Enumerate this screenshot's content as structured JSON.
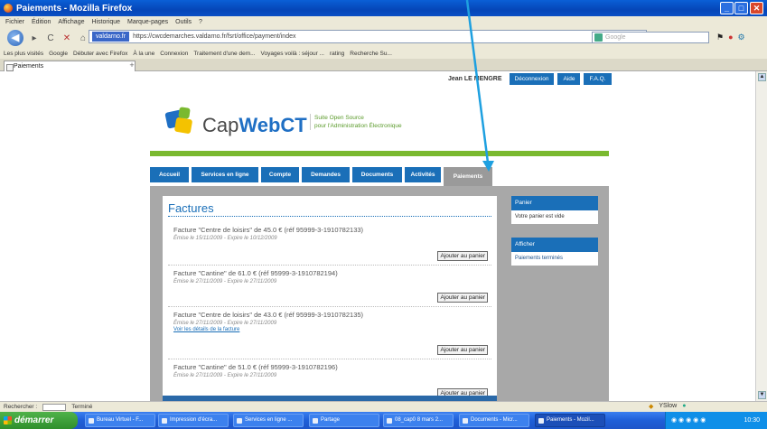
{
  "window": {
    "title": "Paiements - Mozilla Firefox",
    "controls": [
      "_",
      "□",
      "✕"
    ]
  },
  "menu": [
    "Fichier",
    "Édition",
    "Affichage",
    "Historique",
    "Marque-pages",
    "Outils",
    "?"
  ],
  "nav": {
    "back_icon": "◀",
    "forward_icon": "▸",
    "reload_icon": "C",
    "stop_icon": "✕",
    "home_icon": "⌂",
    "site_label": "valdarno.fr",
    "url": "https://cwcdemarches.valdarno.fr/fsrt/office/payment/index",
    "star_icon": "☆",
    "search_placeholder": "Google",
    "extra_icons": [
      "⚑",
      "●",
      "⚙"
    ]
  },
  "bookmarks": [
    "Les plus visités",
    "Google",
    "Débuter avec Firefox",
    "À la une",
    "Connexion",
    "Traitement d'une dem...",
    "Voyages voilà : séjour ...",
    "rating",
    "Recherche Su..."
  ],
  "browser_tab": {
    "label": "Paiements",
    "new_tab": "+"
  },
  "site": {
    "user": "Jean LE MENGRE",
    "user_buttons": [
      "Déconnexion",
      "Aide",
      "F.A.Q."
    ],
    "logo_cap": "Cap",
    "logo_webct": "WebCT",
    "tagline_1": "Suite Open Source",
    "tagline_2": "pour l'Administration Électronique",
    "tabs": [
      {
        "label": "Accueil",
        "w": 43
      },
      {
        "label": "Services en ligne",
        "w": 74
      },
      {
        "label": "Compte",
        "w": 42
      },
      {
        "label": "Demandes",
        "w": 53
      },
      {
        "label": "Documents",
        "w": 55
      },
      {
        "label": "Activités",
        "w": 40
      },
      {
        "label": "Paiements",
        "w": 54,
        "active": true
      }
    ],
    "section_title": "Factures",
    "invoices": [
      {
        "title": "Facture \"Centre de loisirs\" de 45.0 € (réf 95999-3-1910782133)",
        "dates": "Émise le 15/11/2009 - Expire le 10/12/2009",
        "link": "",
        "button": "Ajouter au panier"
      },
      {
        "title": "Facture \"Cantine\" de 61.0 € (réf 95999-3-1910782194)",
        "dates": "Émise le 27/11/2009 - Expire le 27/11/2009",
        "link": "",
        "button": "Ajouter au panier"
      },
      {
        "title": "Facture \"Centre de loisirs\" de 43.0 € (réf 95999-3-1910782135)",
        "dates": "Émise le 27/11/2009 - Expire le 27/11/2009",
        "link": "Voir les détails de la facture",
        "button": "Ajouter au panier"
      },
      {
        "title": "Facture \"Cantine\" de 51.0 € (réf 95999-3-1910782196)",
        "dates": "Émise le 27/11/2009 - Expire le 27/11/2009",
        "link": "",
        "button": "Ajouter au panier"
      }
    ],
    "sidebar": [
      {
        "header": "Panier",
        "item": "Votre panier est vide"
      },
      {
        "header": "Afficher",
        "item": "Paiements terminés"
      }
    ]
  },
  "status": {
    "find_label": "Rechercher :",
    "text": "Terminé",
    "right_label": "YSlow"
  },
  "taskbar": {
    "start": "démarrer",
    "buttons": [
      "Bureau Virtuel - F...",
      "Impression d'écra...",
      "Services en ligne ...",
      "Partage",
      "08_cap0 8 mars 2...",
      "Documents - Micr...",
      "Paiements - Mozil..."
    ],
    "clock": "10:30"
  },
  "colors": {
    "accent": "#1a6fb8",
    "green": "#7ab92f",
    "arrow": "#1ea0e0"
  }
}
